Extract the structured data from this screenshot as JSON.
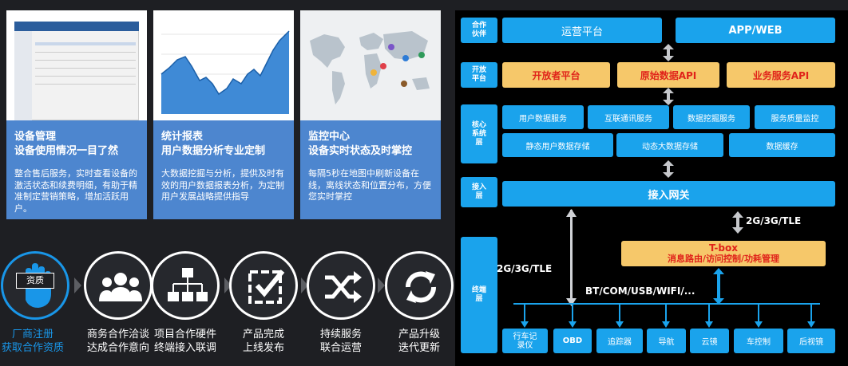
{
  "cards": [
    {
      "title": "设备管理\n设备使用情况一目了然",
      "desc": "整合售后服务，实时查看设备的激活状态和续费明细，有助于精准制定营销策略，增加活跃用户。"
    },
    {
      "title": "统计报表\n用户数据分析专业定制",
      "desc": "大数据挖掘与分析，提供及时有效的用户数据报表分析，为定制用户发展战略提供指导"
    },
    {
      "title": "监控中心\n设备实时状态及时掌控",
      "desc": "每隔5秒在地图中刷新设备在线，离线状态和位置分布，方便您实时掌控"
    }
  ],
  "steps": [
    {
      "icon": "qualification-hand-icon",
      "badge": "资质",
      "label": "厂商注册\n获取合作资质"
    },
    {
      "icon": "people-icon",
      "label": "商务合作洽谈\n达成合作意向"
    },
    {
      "icon": "org-chart-icon",
      "label": "项目合作硬件\n终端接入联调"
    },
    {
      "icon": "checkbox-icon",
      "label": "产品完成\n上线发布"
    },
    {
      "icon": "shuffle-icon",
      "label": "持续服务\n联合运营"
    },
    {
      "icon": "refresh-icon",
      "label": "产品升级\n迭代更新"
    }
  ],
  "arch": {
    "layers": [
      "合作\n伙伴",
      "开放\n平台",
      "核心\n系统\n层",
      "接入\n层",
      "终端\n层"
    ],
    "partner": [
      "运营平台",
      "APP/WEB"
    ],
    "open": [
      "开放者平台",
      "原始数据API",
      "业务服务API"
    ],
    "core_top": [
      "用户数据服务",
      "互联通讯服务",
      "数据挖掘服务",
      "服务质量监控"
    ],
    "core_bottom": [
      "静态用户数据存储",
      "动态大数据存储",
      "数据缓存"
    ],
    "gateway": "接入网关",
    "net_right": "2G/3G/TLE",
    "net_left": "2G/3G/TLE",
    "tbox_title": "T-box",
    "tbox_sub": "消息路由/访问控制/功耗管理",
    "bus": "BT/COM/USB/WIFI/...",
    "terminals": [
      "行车记\n录仪",
      "OBD",
      "追踪器",
      "导航",
      "云镜",
      "车控制",
      "后视镜"
    ]
  }
}
